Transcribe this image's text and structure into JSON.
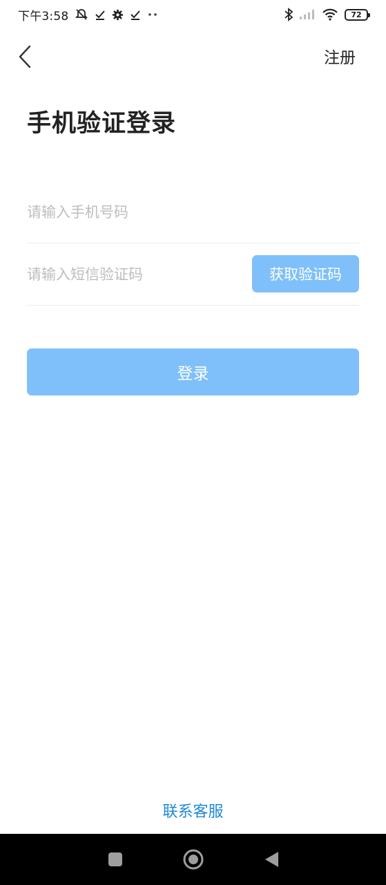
{
  "status_bar": {
    "time": "下午3:58",
    "battery": "72",
    "icons_left": [
      "alarm-off-icon",
      "check-icon",
      "gear-icon",
      "check-icon",
      "more-dots-icon"
    ],
    "icons_right": [
      "bluetooth-icon",
      "signal-icon",
      "wifi-icon",
      "battery-icon"
    ]
  },
  "header": {
    "back_icon": "chevron-left-icon",
    "register_label": "注册"
  },
  "page": {
    "title": "手机验证登录"
  },
  "form": {
    "phone_placeholder": "请输入手机号码",
    "phone_value": "",
    "code_placeholder": "请输入短信验证码",
    "code_value": "",
    "get_code_label": "获取验证码",
    "login_label": "登录"
  },
  "footer": {
    "contact_label": "联系客服"
  },
  "colors": {
    "primary_disabled": "#7fc0fa",
    "link": "#1e88d6"
  },
  "system_nav": {
    "keys": [
      "recent-apps-icon",
      "home-icon",
      "back-triangle-icon"
    ]
  }
}
